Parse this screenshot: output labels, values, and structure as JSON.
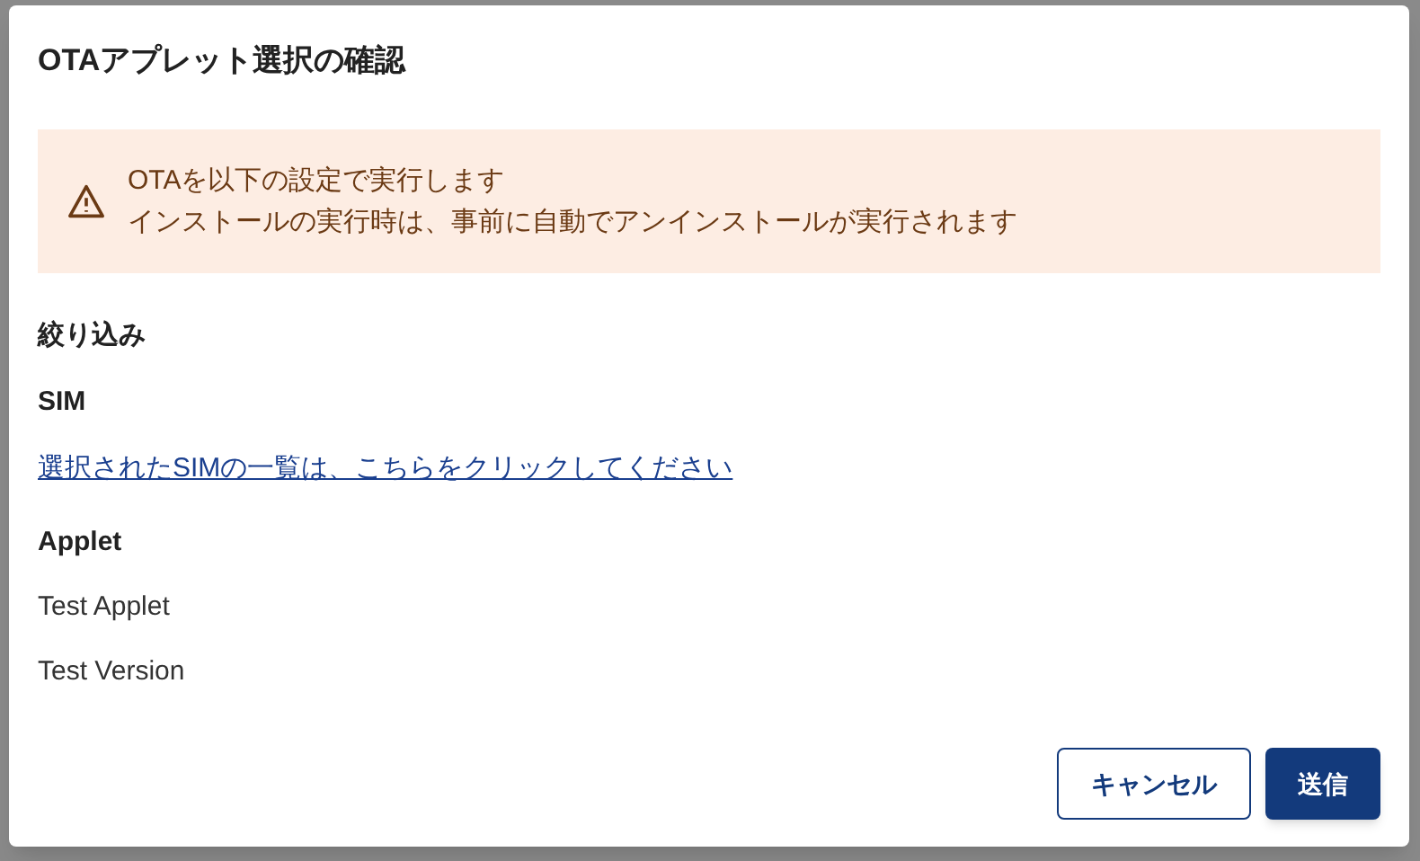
{
  "dialog": {
    "title": "OTAアプレット選択の確認",
    "warning": {
      "lines": [
        "OTAを以下の設定で実行します",
        "インストールの実行時は、事前に自動でアンインストールが実行されます"
      ]
    },
    "sections": [
      {
        "kind": "heading",
        "text": "絞り込み"
      },
      {
        "kind": "subheading",
        "text": "SIM"
      },
      {
        "kind": "link",
        "text": "選択されたSIMの一覧は、こちらをクリックしてください"
      },
      {
        "kind": "subheading",
        "text": "Applet"
      },
      {
        "kind": "value",
        "text": "Test Applet"
      },
      {
        "kind": "value",
        "text": "Test Version"
      }
    ],
    "buttons": [
      {
        "kind": "outlined",
        "label": "キャンセル"
      },
      {
        "kind": "filled",
        "label": "送信"
      }
    ]
  }
}
